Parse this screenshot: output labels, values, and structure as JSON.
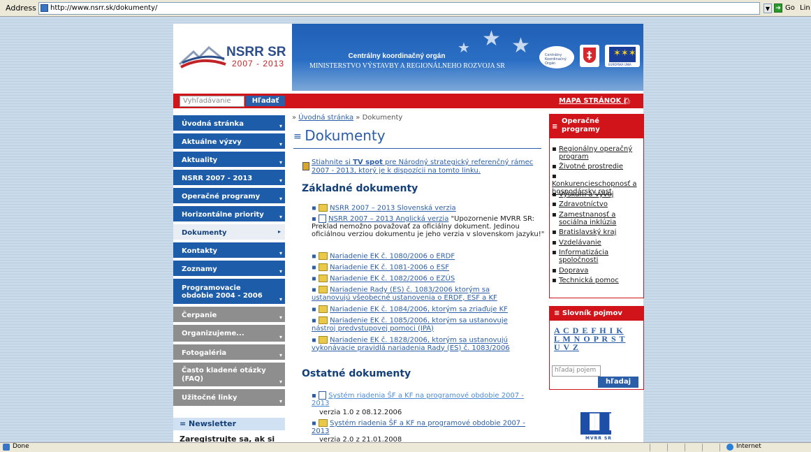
{
  "browser": {
    "address_label": "Address",
    "url": "http://www.nsrr.sk/dokumenty/",
    "go_label": "Go",
    "links_label": "Lin",
    "status_text": "Done",
    "zone_text": "Internet"
  },
  "header": {
    "logo_title": "NSRR SR",
    "logo_years": "2007 - 2013",
    "banner_title": "Centrálny koordinačný orgán",
    "banner_subtitle": "MINISTERSTVO VÝSTAVBY A REGIONÁLNEHO ROZVOJA SR",
    "emblem_text": "Centrálny Koordinačný Orgán",
    "eu_text": "EURÓPSKA ÚNIA"
  },
  "topbar": {
    "search_placeholder": "Vyhľadávanie",
    "search_button": "Hľadať",
    "sitemap_label": "MAPA STRÁNOK |"
  },
  "nav": {
    "items": [
      {
        "label": "Úvodná stránka"
      },
      {
        "label": "Aktuálne výzvy"
      },
      {
        "label": "Aktuality"
      },
      {
        "label": "NSRR 2007 - 2013"
      },
      {
        "label": "Operačné programy"
      },
      {
        "label": "Horizontálne priority"
      },
      {
        "label": "Dokumenty"
      },
      {
        "label": "Kontakty"
      },
      {
        "label": "Zoznamy"
      },
      {
        "label": "Programovacie obdobie 2004 - 2006"
      },
      {
        "label": "Čerpanie"
      },
      {
        "label": "Organizujeme..."
      },
      {
        "label": "Fotogaléria"
      },
      {
        "label": "Často kladené otázky (FAQ)"
      },
      {
        "label": "Užitočné linky"
      }
    ],
    "newsletter_title": "Newsletter",
    "newsletter_text": "Zaregistrujte sa, ak si"
  },
  "main": {
    "breadcrumb_home": "Úvodná stránka",
    "breadcrumb_current": "Dokumenty",
    "title": "Dokumenty",
    "tv_prefix": "Stiahnite si ",
    "tv_bold": "TV spot",
    "tv_suffix": " pre Národný strategický referenčný rámec 2007 - 2013, ktorý je k dispozícii na tomto linku.",
    "basic_heading": "Základné dokumenty",
    "basic_docs": [
      {
        "link": "NSRR 2007 – 2013 Slovenská verzia",
        "note": ""
      },
      {
        "link": "NSRR 2007 – 2013 Anglická verzia",
        "note": " \"Upozornenie MVRR SR: Preklad nemožno považovať za oficiálny dokument. Jedinou oficiálnou verziou dokumentu je jeho verzia v slovenskom jazyku!\""
      },
      {
        "link": "Nariadenie EK č. 1080/2006 o ERDF",
        "note": ""
      },
      {
        "link": "Nariadenie EK č. 1081-2006 o ESF",
        "note": ""
      },
      {
        "link": "Nariadenie EK č. 1082/2006 o EZÚS",
        "note": ""
      },
      {
        "link": "Nariadenie Rady (ES) č. 1083/2006 ktorým sa ustanovujú všeobecné ustanovenia o ERDF, ESF a KF",
        "note": ""
      },
      {
        "link": "Nariadenie EK č. 1084/2006, ktorým sa zriaďuje KF",
        "note": ""
      },
      {
        "link": "Nariadenie EK č. 1085/2006, ktorým sa ustanovuje nástroj predvstupovej pomoci (IPA)",
        "note": ""
      },
      {
        "link": "Nariadenie EK č. 1828/2006, ktorým sa ustanovujú vykonávacie pravidlá nariadenia Rady (ES) č. 1083/2006",
        "note": ""
      }
    ],
    "other_heading": "Ostatné dokumenty",
    "other_docs": [
      {
        "link": "Systém riadenia ŠF a KF na programové obdobie 2007 - 2013",
        "version": "verzia 1.0 z 08.12.2006"
      },
      {
        "link": "Systém riadenia ŠF a KF na programové obdobie 2007 - 2013",
        "version": "verzia 2.0 z 21.01.2008"
      }
    ]
  },
  "right": {
    "op_title": "Operačné programy",
    "op_items": [
      "Regionálny operačný program",
      "Životné prostredie",
      "Konkurencieschopnosť a hospodársky rast",
      "Výskum a vývoj",
      "Zdravotníctvo",
      "Zamestnanosť a sociálna inklúzia",
      "Bratislavský kraj",
      "Vzdelávanie",
      "Informatizácia spoločnosti",
      "Doprava",
      "Technická pomoc"
    ],
    "glossary_title": "Slovník pojmov",
    "glossary_letters_1": "A C D E F H I K",
    "glossary_letters_2": "L M N O P R S T",
    "glossary_letters_3": "U V Z",
    "glossary_placeholder": "hľadaj pojem",
    "glossary_button": "hľadaj",
    "mvrr_text": "MVRR SR"
  },
  "colors": {
    "nav_blue": "#1d5ca8",
    "brand_red": "#d0141a",
    "link_blue": "#2a5ea8"
  }
}
